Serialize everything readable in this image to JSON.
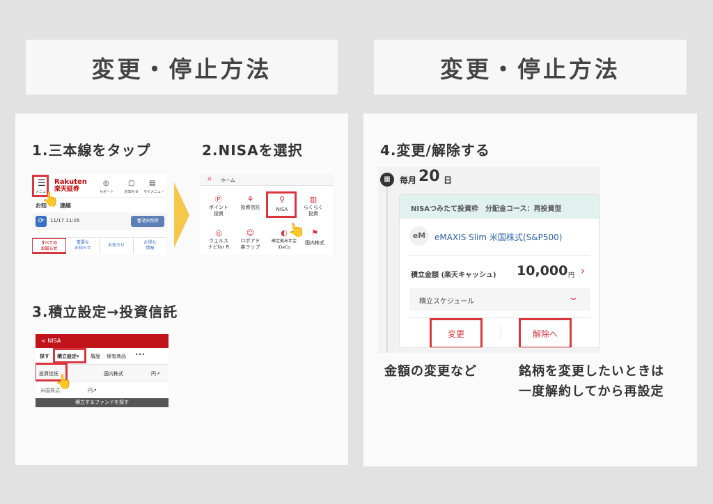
{
  "left": {
    "banner": "変更・停止方法",
    "step1": {
      "title": "1.三本線をタップ",
      "brand_top": "Rakuten",
      "brand_bottom": "楽天証券",
      "menu_label": "メニュー",
      "support": "サポート",
      "notice": "お知らせ",
      "mymenu": "マイメニュー",
      "notice_title": "お知",
      "notice_title_tail": "連絡",
      "datetime": "11/17 11:05",
      "delete_btn": "選択削除",
      "tabs": [
        "すべての\nお知らせ",
        "重要な\nお知らせ",
        "お知らせ",
        "お得な\n情報"
      ]
    },
    "step2": {
      "title": "2.NISAを選択",
      "home": "ホーム",
      "items": [
        "ポイント\n投資",
        "投資信託",
        "NISA",
        "らくらく\n投資",
        "ウェルス\nナビfor R",
        "ロボアド\n楽ラップ",
        "確定拠出年金\niDeCo",
        "国内株式"
      ]
    },
    "step3": {
      "title": "3.積立設定→投資信託",
      "back": "< NISA",
      "nav": [
        "探す",
        "積立設定",
        "履歴",
        "保有商品",
        "•••"
      ],
      "dropdown_arrow": "▾",
      "row1": [
        "投資信託",
        "国内株式",
        "円↗"
      ],
      "row2": [
        "米国株式",
        "円↗"
      ],
      "footer": "積立するファンドを探す"
    }
  },
  "right": {
    "banner": "変更・停止方法",
    "step4": {
      "title": "4.変更/解除する",
      "schedule_prefix": "毎月",
      "schedule_day": "20",
      "schedule_suffix": "日",
      "card_header": "NISAつみたて投資枠　分配金コース：再投資型",
      "fund_badge": "eM",
      "fund_name": "eMAXIS Slim 米国株式(S&P500)",
      "amount_label": "積立金額 (楽天キャッシュ)",
      "amount_value": "10,000",
      "amount_unit": "円",
      "schedule_label": "積立スケジュール",
      "change_btn": "変更",
      "cancel_btn": "解除へ"
    },
    "caption_left": "金額の変更など",
    "caption_right_1": "銘柄を変更したいときは",
    "caption_right_2": "一度解約してから再設定"
  },
  "colors": {
    "red": "#d9363e",
    "arrow": "#f5c84a",
    "fund_blue": "#2a5ea8",
    "card_header_bg": "#e1f1ee"
  }
}
